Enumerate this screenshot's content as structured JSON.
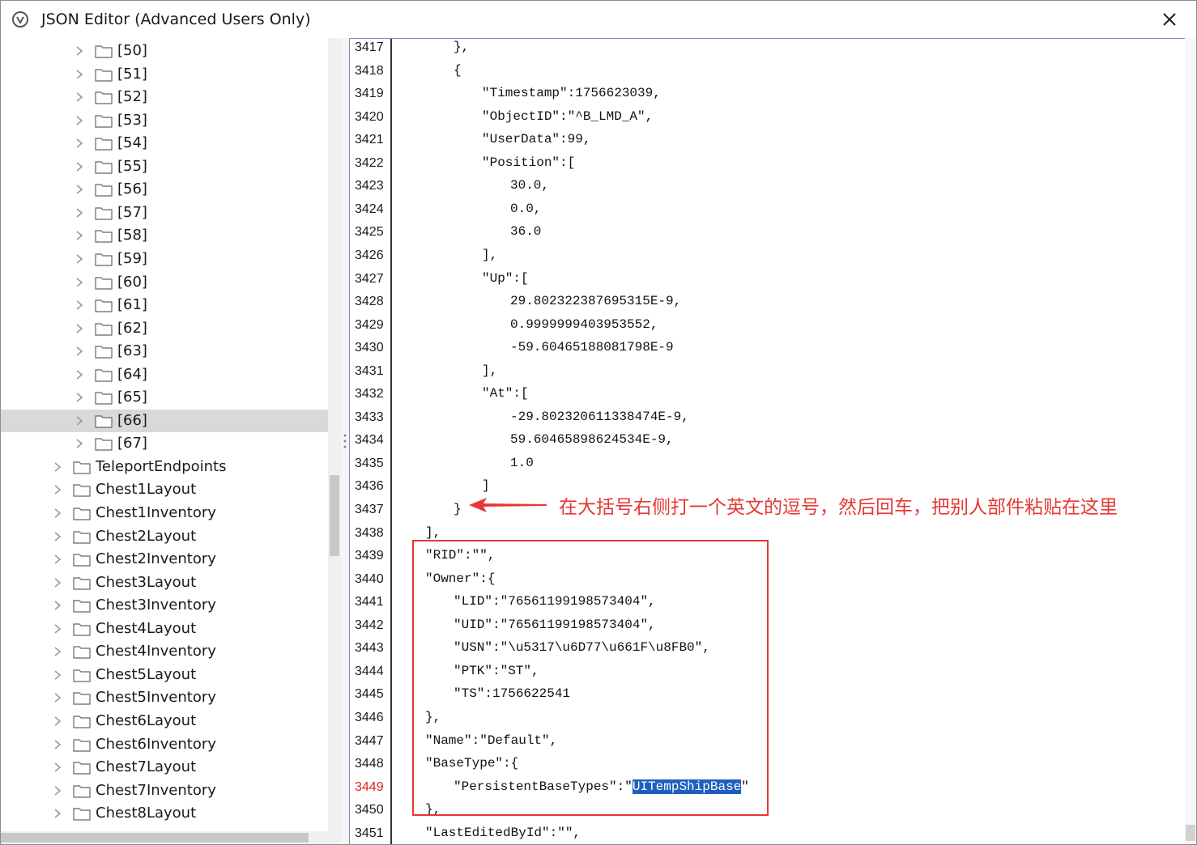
{
  "window": {
    "title": "JSON Editor (Advanced Users Only)"
  },
  "tree": {
    "items": [
      {
        "label": "[50]",
        "depth": 2
      },
      {
        "label": "[51]",
        "depth": 2
      },
      {
        "label": "[52]",
        "depth": 2
      },
      {
        "label": "[53]",
        "depth": 2
      },
      {
        "label": "[54]",
        "depth": 2
      },
      {
        "label": "[55]",
        "depth": 2
      },
      {
        "label": "[56]",
        "depth": 2
      },
      {
        "label": "[57]",
        "depth": 2
      },
      {
        "label": "[58]",
        "depth": 2
      },
      {
        "label": "[59]",
        "depth": 2
      },
      {
        "label": "[60]",
        "depth": 2
      },
      {
        "label": "[61]",
        "depth": 2
      },
      {
        "label": "[62]",
        "depth": 2
      },
      {
        "label": "[63]",
        "depth": 2
      },
      {
        "label": "[64]",
        "depth": 2
      },
      {
        "label": "[65]",
        "depth": 2
      },
      {
        "label": "[66]",
        "depth": 2,
        "selected": true
      },
      {
        "label": "[67]",
        "depth": 2
      },
      {
        "label": "TeleportEndpoints",
        "depth": 1
      },
      {
        "label": "Chest1Layout",
        "depth": 1
      },
      {
        "label": "Chest1Inventory",
        "depth": 1
      },
      {
        "label": "Chest2Layout",
        "depth": 1
      },
      {
        "label": "Chest2Inventory",
        "depth": 1
      },
      {
        "label": "Chest3Layout",
        "depth": 1
      },
      {
        "label": "Chest3Inventory",
        "depth": 1
      },
      {
        "label": "Chest4Layout",
        "depth": 1
      },
      {
        "label": "Chest4Inventory",
        "depth": 1
      },
      {
        "label": "Chest5Layout",
        "depth": 1
      },
      {
        "label": "Chest5Inventory",
        "depth": 1
      },
      {
        "label": "Chest6Layout",
        "depth": 1
      },
      {
        "label": "Chest6Inventory",
        "depth": 1
      },
      {
        "label": "Chest7Layout",
        "depth": 1
      },
      {
        "label": "Chest7Inventory",
        "depth": 1
      },
      {
        "label": "Chest8Layout",
        "depth": 1
      }
    ]
  },
  "editor": {
    "current_line": 3449,
    "lines": [
      {
        "n": 3417,
        "indent": 4,
        "text": "},"
      },
      {
        "n": 3418,
        "indent": 4,
        "text": "{"
      },
      {
        "n": 3419,
        "indent": 5,
        "text": "\"Timestamp\":1756623039,"
      },
      {
        "n": 3420,
        "indent": 5,
        "text": "\"ObjectID\":\"^B_LMD_A\","
      },
      {
        "n": 3421,
        "indent": 5,
        "text": "\"UserData\":99,"
      },
      {
        "n": 3422,
        "indent": 5,
        "text": "\"Position\":["
      },
      {
        "n": 3423,
        "indent": 6,
        "text": "30.0,"
      },
      {
        "n": 3424,
        "indent": 6,
        "text": "0.0,"
      },
      {
        "n": 3425,
        "indent": 6,
        "text": "36.0"
      },
      {
        "n": 3426,
        "indent": 5,
        "text": "],"
      },
      {
        "n": 3427,
        "indent": 5,
        "text": "\"Up\":["
      },
      {
        "n": 3428,
        "indent": 6,
        "text": "29.802322387695315E-9,"
      },
      {
        "n": 3429,
        "indent": 6,
        "text": "0.9999999403953552,"
      },
      {
        "n": 3430,
        "indent": 6,
        "text": "-59.60465188081798E-9"
      },
      {
        "n": 3431,
        "indent": 5,
        "text": "],"
      },
      {
        "n": 3432,
        "indent": 5,
        "text": "\"At\":["
      },
      {
        "n": 3433,
        "indent": 6,
        "text": "-29.802320611338474E-9,"
      },
      {
        "n": 3434,
        "indent": 6,
        "text": "59.60465898624534E-9,"
      },
      {
        "n": 3435,
        "indent": 6,
        "text": "1.0"
      },
      {
        "n": 3436,
        "indent": 5,
        "text": "]"
      },
      {
        "n": 3437,
        "indent": 4,
        "text": "}"
      },
      {
        "n": 3438,
        "indent": 3,
        "text": "],"
      },
      {
        "n": 3439,
        "indent": 3,
        "text": "\"RID\":\"\","
      },
      {
        "n": 3440,
        "indent": 3,
        "text": "\"Owner\":{"
      },
      {
        "n": 3441,
        "indent": 4,
        "text": "\"LID\":\"76561199198573404\","
      },
      {
        "n": 3442,
        "indent": 4,
        "text": "\"UID\":\"76561199198573404\","
      },
      {
        "n": 3443,
        "indent": 4,
        "text": "\"USN\":\"\\u5317\\u6D77\\u661F\\u8FB0\","
      },
      {
        "n": 3444,
        "indent": 4,
        "text": "\"PTK\":\"ST\","
      },
      {
        "n": 3445,
        "indent": 4,
        "text": "\"TS\":1756622541"
      },
      {
        "n": 3446,
        "indent": 3,
        "text": "},"
      },
      {
        "n": 3447,
        "indent": 3,
        "text": "\"Name\":\"Default\","
      },
      {
        "n": 3448,
        "indent": 3,
        "text": "\"BaseType\":{"
      },
      {
        "n": 3449,
        "indent": 4,
        "text": "\"PersistentBaseTypes\":\"",
        "hl": "UITempShipBase",
        "after": "\""
      },
      {
        "n": 3450,
        "indent": 3,
        "text": "},"
      },
      {
        "n": 3451,
        "indent": 3,
        "text": "\"LastEditedById\":\"\","
      }
    ]
  },
  "annotation": {
    "text": "在大括号右侧打一个英文的逗号，然后回车，把别人部件粘贴在这里",
    "color": "#e53935"
  },
  "colors": {
    "selection": "#1f5fbf",
    "tree_selected": "#d9d9d9"
  }
}
